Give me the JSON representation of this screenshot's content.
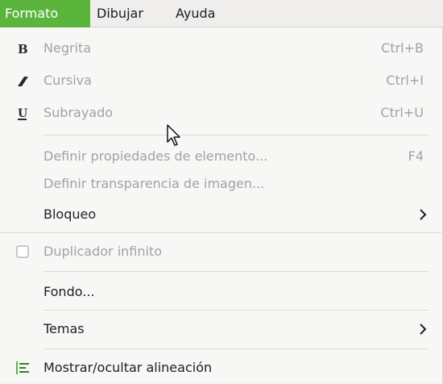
{
  "menubar": {
    "items": [
      {
        "label": "Formato",
        "active": true
      },
      {
        "label": "Dibujar",
        "active": false
      },
      {
        "label": "Ayuda",
        "active": false
      }
    ]
  },
  "menu": {
    "items": [
      {
        "icon": "bold-icon",
        "label": "Negrita",
        "accel": "Ctrl+B",
        "enabled": false
      },
      {
        "icon": "italic-icon",
        "label": "Cursiva",
        "accel": "Ctrl+I",
        "enabled": false
      },
      {
        "icon": "underline-icon",
        "label": "Subrayado",
        "accel": "Ctrl+U",
        "enabled": false
      },
      {
        "label": "Definir propiedades de elemento...",
        "accel": "F4",
        "enabled": false
      },
      {
        "label": "Definir transparencia de imagen...",
        "enabled": false
      },
      {
        "label": "Bloqueo",
        "submenu": true,
        "enabled": true
      },
      {
        "icon": "checkbox-icon",
        "label": "Duplicador infinito",
        "enabled": false,
        "checked": false
      },
      {
        "label": "Fondo...",
        "enabled": true
      },
      {
        "label": "Temas",
        "submenu": true,
        "enabled": true
      },
      {
        "icon": "align-icon",
        "label": "Mostrar/ocultar alineación",
        "enabled": true
      }
    ]
  },
  "colors": {
    "accent": "#5bb53d",
    "disabled_text": "#a2a2a2",
    "menu_bg": "#f7f7f6"
  }
}
